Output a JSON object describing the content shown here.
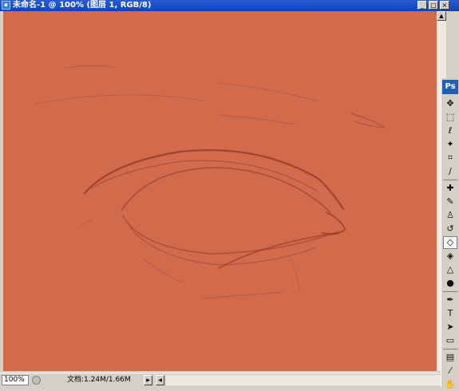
{
  "window": {
    "title": "未命名-1 @ 100% (图层 1, RGB/8)",
    "app_icon": "photoshop-doc-icon",
    "controls": {
      "minimize": "_",
      "maximize": "□",
      "close": "×"
    }
  },
  "canvas": {
    "background": "#d26a4c",
    "stroke_color": "#8e3a26",
    "content": "pencil sketch of an eye"
  },
  "status": {
    "zoom": "100%",
    "doc_info": "文档:1.24M/1.66M",
    "arrow": "▶"
  },
  "toolbox": {
    "logo": "Ps",
    "tools": [
      {
        "name": "move-tool-icon",
        "glyph": "✥"
      },
      {
        "name": "marquee-tool-icon",
        "glyph": "⬚"
      },
      {
        "name": "lasso-tool-icon",
        "glyph": "ℓ"
      },
      {
        "name": "magic-wand-icon",
        "glyph": "✦"
      },
      {
        "name": "crop-tool-icon",
        "glyph": "⌗"
      },
      {
        "name": "slice-tool-icon",
        "glyph": "∕"
      },
      {
        "name": "healing-brush-icon",
        "glyph": "✚"
      },
      {
        "name": "brush-tool-icon",
        "glyph": "✎"
      },
      {
        "name": "clone-stamp-icon",
        "glyph": "♙"
      },
      {
        "name": "history-brush-icon",
        "glyph": "↺"
      },
      {
        "name": "eraser-tool-icon",
        "glyph": "◇"
      },
      {
        "name": "paint-bucket-icon",
        "glyph": "◈"
      },
      {
        "name": "blur-tool-icon",
        "glyph": "△"
      },
      {
        "name": "dodge-tool-icon",
        "glyph": "●"
      },
      {
        "name": "pen-tool-icon",
        "glyph": "✒"
      },
      {
        "name": "type-tool-icon",
        "glyph": "T"
      },
      {
        "name": "path-selection-icon",
        "glyph": "➤"
      },
      {
        "name": "shape-tool-icon",
        "glyph": "▭"
      },
      {
        "name": "notes-tool-icon",
        "glyph": "▤"
      },
      {
        "name": "eyedropper-icon",
        "glyph": "⁄"
      },
      {
        "name": "hand-tool-icon",
        "glyph": "✋"
      }
    ],
    "active_tool": "eraser-tool-icon"
  }
}
